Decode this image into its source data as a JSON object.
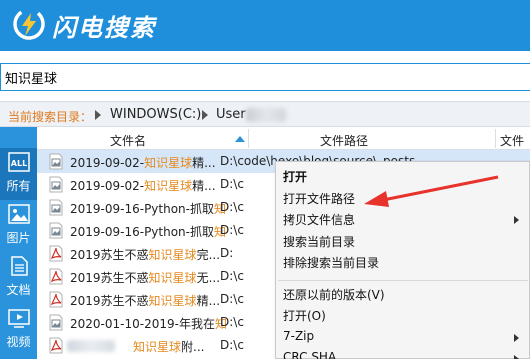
{
  "app": {
    "title": "闪电搜索",
    "logo_icon": "lightning-icon"
  },
  "search": {
    "value": "知识星球"
  },
  "breadcrumb": {
    "label": "当前搜索目录：",
    "items": [
      "WINDOWS(C:)",
      "User"
    ]
  },
  "sidebar": {
    "items": [
      {
        "label": "所有",
        "icon": "all-icon"
      },
      {
        "label": "图片",
        "icon": "picture-icon"
      },
      {
        "label": "文档",
        "icon": "document-icon"
      },
      {
        "label": "视频",
        "icon": "video-icon"
      }
    ]
  },
  "table": {
    "columns": [
      "文件名",
      "文件路径",
      "文件大"
    ],
    "rows": [
      {
        "icon": "image-file-icon",
        "pre": "2019-09-02-",
        "hl": "知识星球",
        "post": "精...",
        "path": "D:\\code\\hexo\\blog\\source\\_posts"
      },
      {
        "icon": "image-file-icon",
        "pre": "2019-09-02-",
        "hl": "知识星球",
        "post": "精...",
        "path": "D:\\c"
      },
      {
        "icon": "image-file-icon",
        "pre": "2019-09-16-Python-抓取",
        "hl": "知",
        "post": "",
        "path": "D:\\c"
      },
      {
        "icon": "image-file-icon",
        "pre": "2019-09-16-Python-抓取",
        "hl": "知",
        "post": "",
        "path": "D:\\c"
      },
      {
        "icon": "pdf-file-icon",
        "pre": "2019苏生不惑",
        "hl": "知识星球",
        "post": "完...",
        "path": "D:"
      },
      {
        "icon": "pdf-file-icon",
        "pre": "2019苏生不惑",
        "hl": "知识星球",
        "post": "无...",
        "path": "D:\\c"
      },
      {
        "icon": "pdf-file-icon",
        "pre": "2019苏生不惑",
        "hl": "知识星球",
        "post": "精...",
        "path": "D:\\c"
      },
      {
        "icon": "image-file-icon",
        "pre": "2020-01-10-2019-年我在",
        "hl": "知",
        "post": "",
        "path": "D:\\c"
      },
      {
        "icon": "pdf-file-icon",
        "pre": "",
        "hl": "知识星球",
        "post": "附...",
        "path": "D:\\c"
      }
    ]
  },
  "context_menu": {
    "items": [
      {
        "label": "打开",
        "bold": true
      },
      {
        "label": "打开文件路径"
      },
      {
        "label": "拷贝文件信息",
        "submenu": true
      },
      {
        "label": "搜索当前目录"
      },
      {
        "label": "排除搜索当前目录"
      },
      {
        "separator": true
      },
      {
        "label": "还原以前的版本(V)"
      },
      {
        "label": "打开(O)"
      },
      {
        "label": "7-Zip",
        "submenu": true
      },
      {
        "label": "CRC SHA",
        "submenu": true
      }
    ]
  },
  "colors": {
    "brand": "#1f8fdc",
    "highlight": "#e68a1e",
    "annotation": "#e8322c"
  }
}
